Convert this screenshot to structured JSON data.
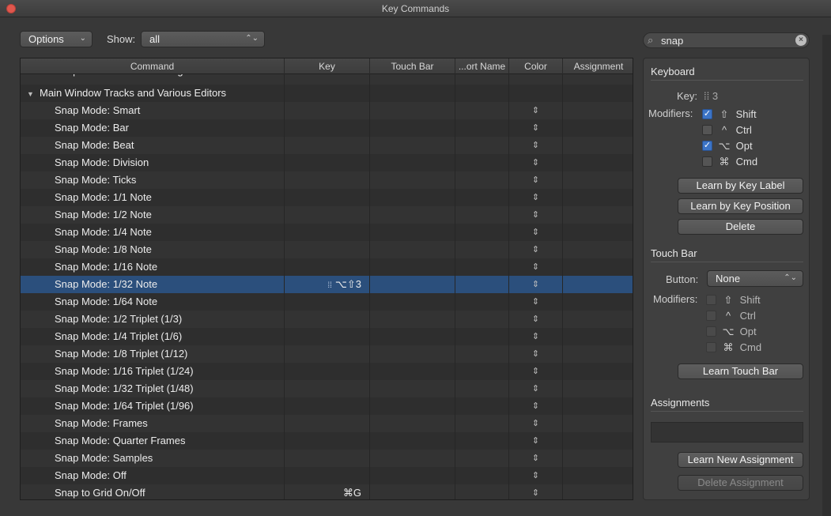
{
  "window": {
    "title": "Key Commands"
  },
  "toolbar": {
    "options_label": "Options",
    "show_label": "Show:",
    "show_value": "all",
    "search_value": "snap"
  },
  "table": {
    "headers": [
      "Command",
      "Key",
      "Touch Bar",
      "...ort Name",
      "Color",
      "Assignment"
    ],
    "partial_row": "Snap Edits to Zero Crossings",
    "group": "Main Window Tracks and Various Editors",
    "rows": [
      {
        "command": "Snap Mode: Smart",
        "key": ""
      },
      {
        "command": "Snap Mode: Bar",
        "key": ""
      },
      {
        "command": "Snap Mode: Beat",
        "key": ""
      },
      {
        "command": "Snap Mode: Division",
        "key": ""
      },
      {
        "command": "Snap Mode: Ticks",
        "key": ""
      },
      {
        "command": "Snap Mode: 1/1 Note",
        "key": ""
      },
      {
        "command": "Snap Mode: 1/2 Note",
        "key": ""
      },
      {
        "command": "Snap Mode: 1/4 Note",
        "key": ""
      },
      {
        "command": "Snap Mode: 1/8 Note",
        "key": ""
      },
      {
        "command": "Snap Mode: 1/16 Note",
        "key": ""
      },
      {
        "command": "Snap Mode: 1/32 Note",
        "key": "⌥⇧3",
        "selected": true
      },
      {
        "command": "Snap Mode: 1/64 Note",
        "key": ""
      },
      {
        "command": "Snap Mode: 1/2 Triplet (1/3)",
        "key": ""
      },
      {
        "command": "Snap Mode: 1/4 Triplet (1/6)",
        "key": ""
      },
      {
        "command": "Snap Mode: 1/8 Triplet (1/12)",
        "key": ""
      },
      {
        "command": "Snap Mode: 1/16 Triplet (1/24)",
        "key": ""
      },
      {
        "command": "Snap Mode: 1/32 Triplet (1/48)",
        "key": ""
      },
      {
        "command": "Snap Mode: 1/64 Triplet (1/96)",
        "key": ""
      },
      {
        "command": "Snap Mode: Frames",
        "key": ""
      },
      {
        "command": "Snap Mode: Quarter Frames",
        "key": ""
      },
      {
        "command": "Snap Mode: Samples",
        "key": ""
      },
      {
        "command": "Snap Mode: Off",
        "key": ""
      },
      {
        "command": "Snap to Grid On/Off",
        "key": "⌘G"
      }
    ]
  },
  "keyboard": {
    "title": "Keyboard",
    "key_label": "Key:",
    "key_value": "3",
    "modifiers_label": "Modifiers:",
    "modifiers": [
      {
        "symbol": "⇧",
        "name": "Shift",
        "checked": true
      },
      {
        "symbol": "^",
        "name": "Ctrl",
        "checked": false
      },
      {
        "symbol": "⌥",
        "name": "Opt",
        "checked": true
      },
      {
        "symbol": "⌘",
        "name": "Cmd",
        "checked": false
      }
    ],
    "learn_label": "Learn by Key Label",
    "learn_position": "Learn by Key Position",
    "delete": "Delete"
  },
  "touchbar": {
    "title": "Touch Bar",
    "button_label": "Button:",
    "button_value": "None",
    "modifiers_label": "Modifiers:",
    "modifiers": [
      {
        "symbol": "⇧",
        "name": "Shift"
      },
      {
        "symbol": "^",
        "name": "Ctrl"
      },
      {
        "symbol": "⌥",
        "name": "Opt"
      },
      {
        "symbol": "⌘",
        "name": "Cmd"
      }
    ],
    "learn": "Learn Touch Bar"
  },
  "assignments": {
    "title": "Assignments",
    "learn_new": "Learn New Assignment",
    "delete": "Delete Assignment"
  },
  "colors": {
    "selected_row": "#2b4f7c",
    "checkbox_on": "#3c74c6",
    "close_button": "#e0574d"
  }
}
